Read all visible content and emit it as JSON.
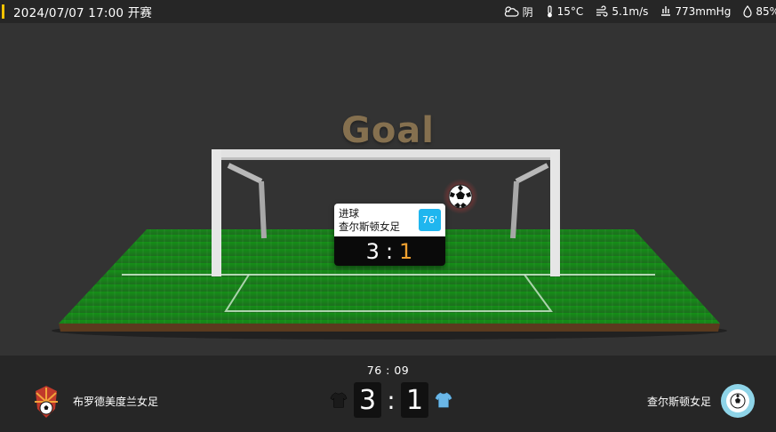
{
  "header": {
    "kickoff": "2024/07/07 17:00 开赛",
    "weather": {
      "condition": "阴",
      "temperature": "15°C",
      "wind": "5.1m/s",
      "pressure": "773mmHg",
      "humidity": "85%"
    }
  },
  "animation": {
    "title": "Goal",
    "event": {
      "type": "进球",
      "team": "查尔斯顿女足",
      "minute": "76'",
      "home_score": "3",
      "separator": ":",
      "away_score": "1"
    }
  },
  "scoreboard": {
    "clock": "76 : 09",
    "home": {
      "name": "布罗德美度兰女足",
      "score": "3",
      "shirt_color": "#1a1a1a"
    },
    "away": {
      "name": "查尔斯顿女足",
      "score": "1",
      "shirt_color": "#6ab7e8"
    },
    "separator": ":"
  },
  "colors": {
    "accent": "#f2c200",
    "goal_text": "#85704f",
    "minute_badge": "#1fb6ef",
    "away_score_highlight": "#f0a030",
    "pitch": "#1c8a1f"
  }
}
